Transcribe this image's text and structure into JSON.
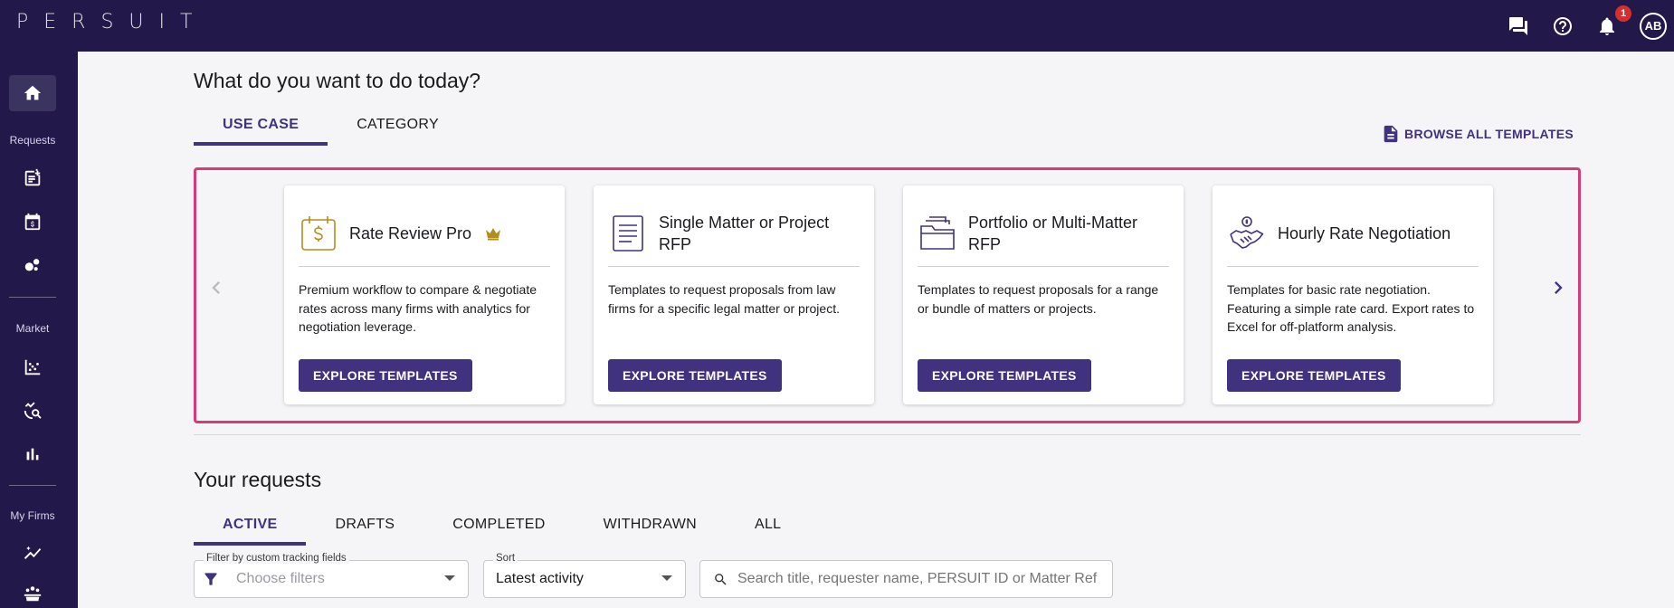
{
  "app": {
    "logo": "PERSUIT"
  },
  "topbar": {
    "notification_count": "1",
    "avatar_initials": "AB"
  },
  "sidebar": {
    "sections": {
      "requests": "Requests",
      "market": "Market",
      "my_firms": "My Firms"
    }
  },
  "main": {
    "title": "What do you want to do today?",
    "tabs": [
      {
        "label": "USE CASE"
      },
      {
        "label": "CATEGORY"
      }
    ],
    "browse_label": "BROWSE ALL TEMPLATES",
    "cards": [
      {
        "title": "Rate Review Pro",
        "description": "Premium workflow to compare & negotiate rates across many firms with analytics for negotiation leverage.",
        "button": "EXPLORE TEMPLATES"
      },
      {
        "title": "Single Matter or Project RFP",
        "description": "Templates to request proposals from law firms for a specific legal matter or project.",
        "button": "EXPLORE TEMPLATES"
      },
      {
        "title": "Portfolio or Multi-Matter RFP",
        "description": "Templates to request proposals for a range or bundle of matters or projects.",
        "button": "EXPLORE TEMPLATES"
      },
      {
        "title": "Hourly Rate Negotiation",
        "description": "Templates for basic rate negotiation. Featuring a simple rate card. Export rates to Excel for off-platform analysis.",
        "button": "EXPLORE TEMPLATES"
      }
    ]
  },
  "requests": {
    "title": "Your requests",
    "tabs": [
      {
        "label": "ACTIVE"
      },
      {
        "label": "DRAFTS"
      },
      {
        "label": "COMPLETED"
      },
      {
        "label": "WITHDRAWN"
      },
      {
        "label": "ALL"
      }
    ],
    "filter": {
      "label": "Filter by custom tracking fields",
      "placeholder": "Choose filters"
    },
    "sort": {
      "label": "Sort",
      "value": "Latest activity"
    },
    "search": {
      "placeholder": "Search title, requester name, PERSUIT ID or Matter Ref"
    }
  },
  "colors": {
    "brand": "#22184a",
    "accent": "#40327f",
    "highlight": "#d63b7a",
    "gold": "#b28e1e"
  }
}
